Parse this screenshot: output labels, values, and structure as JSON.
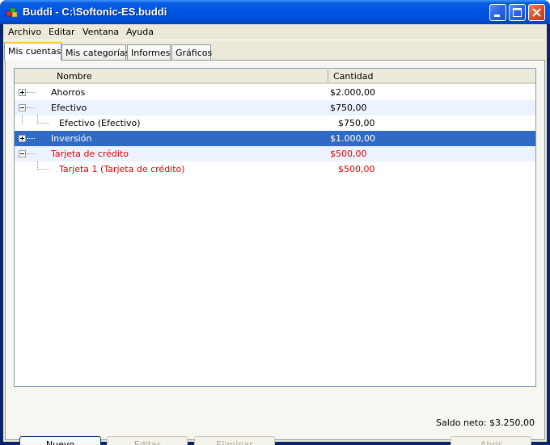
{
  "window": {
    "title": "Buddi - C:\\Softonic-ES.buddi",
    "app_icon": "buddi-app-icon"
  },
  "menu": [
    "Archivo",
    "Editar",
    "Ventana",
    "Ayuda"
  ],
  "tabs": [
    "Mis cuentas",
    "Mis categorías",
    "Informes",
    "Gráficos"
  ],
  "active_tab": 0,
  "table": {
    "headers": [
      "Nombre",
      "Cantidad"
    ],
    "rows": [
      {
        "name": "Ahorros",
        "amount": "$2.000,00",
        "level": 0,
        "expander": "plus",
        "style": "normal"
      },
      {
        "name": "Efectivo",
        "amount": "$750,00",
        "level": 0,
        "expander": "minus",
        "style": "normal"
      },
      {
        "name": "Efectivo (Efectivo)",
        "amount": "$750,00",
        "level": 1,
        "expander": "none",
        "style": "normal"
      },
      {
        "name": "Inversión",
        "amount": "$1.000,00",
        "level": 0,
        "expander": "plus",
        "style": "selected"
      },
      {
        "name": "Tarjeta de crédito",
        "amount": "$500,00",
        "level": 0,
        "expander": "minus",
        "style": "red"
      },
      {
        "name": "Tarjeta 1 (Tarjeta de crédito)",
        "amount": "$500,00",
        "level": 1,
        "expander": "none",
        "style": "red"
      }
    ]
  },
  "footer": {
    "saldo": "Saldo neto: $3.250,00",
    "buttons": {
      "nuevo": "Nuevo",
      "editar": "Editar",
      "eliminar": "Eliminar",
      "abrir": "Abrir"
    }
  },
  "colors": {
    "selection": "#316ac5",
    "negative": "#e00000",
    "titlebar": "#0054e3"
  }
}
